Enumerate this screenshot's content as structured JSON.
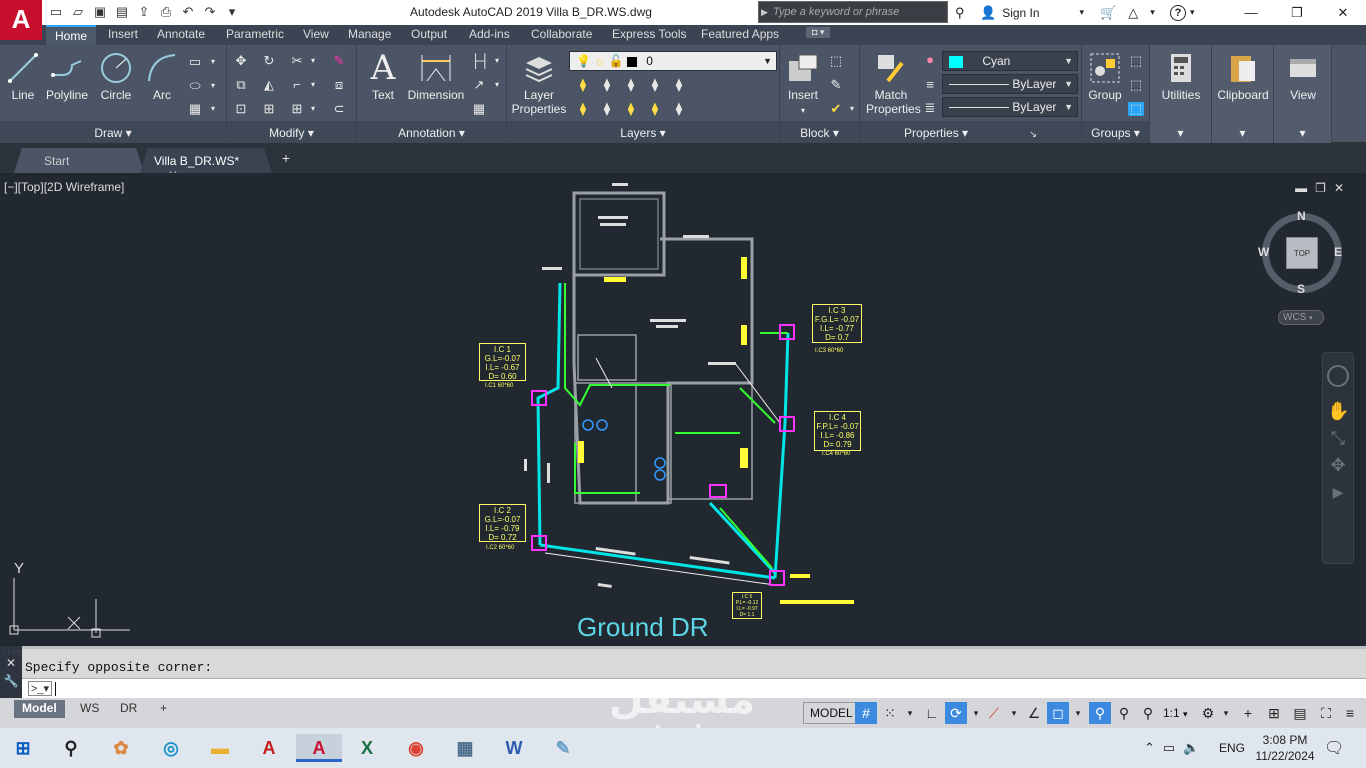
{
  "titlebar": {
    "app_button": "A",
    "window_title": "Autodesk AutoCAD 2019     Villa B_DR.WS.dwg",
    "search_placeholder": "Type a keyword or phrase",
    "sign_in": "Sign In",
    "help": "?"
  },
  "ribbon_tabs": [
    "Home",
    "Insert",
    "Annotate",
    "Parametric",
    "View",
    "Manage",
    "Output",
    "Add-ins",
    "Collaborate",
    "Express Tools",
    "Featured Apps"
  ],
  "panels": {
    "draw": {
      "title": "Draw",
      "line": "Line",
      "polyline": "Polyline",
      "circle": "Circle",
      "arc": "Arc"
    },
    "modify": {
      "title": "Modify"
    },
    "annotation": {
      "title": "Annotation",
      "text": "Text",
      "dimension": "Dimension"
    },
    "layers": {
      "title": "Layers",
      "layer_properties_1": "Layer",
      "layer_properties_2": "Properties",
      "current_layer": "0"
    },
    "block": {
      "title": "Block",
      "insert": "Insert"
    },
    "properties": {
      "title": "Properties",
      "match_1": "Match",
      "match_2": "Properties",
      "color": "Cyan",
      "linetype": "ByLayer",
      "lineweight": "ByLayer"
    },
    "groups": {
      "title": "Groups",
      "group": "Group"
    },
    "utilities": {
      "label": "Utilities"
    },
    "clipboard": {
      "label": "Clipboard"
    },
    "view": {
      "label": "View"
    }
  },
  "file_tabs": [
    {
      "label": "Start"
    },
    {
      "label": "Villa B_DR.WS*"
    }
  ],
  "viewport": {
    "label": "[−][Top][2D Wireframe]",
    "drawing_title": "Ground DR",
    "viewcube": {
      "top": "TOP",
      "n": "N",
      "s": "S",
      "e": "E",
      "w": "W",
      "wcs": "WCS"
    },
    "ucs": {
      "x": "X",
      "y": "Y"
    },
    "inspection_chambers": [
      {
        "id": "I.C 1",
        "lines": [
          "I.C 1",
          "G.L=-0.07",
          "I.L= -0.67",
          "D= 0.60"
        ],
        "size": "I.C1 60*60"
      },
      {
        "id": "I.C 2",
        "lines": [
          "I.C 2",
          "G.L=-0.07",
          "I.L= -0.79",
          "D= 0.72"
        ],
        "size": "I.C2 60*60"
      },
      {
        "id": "I.C 3",
        "lines": [
          "I.C 3",
          "F.G.L= -0.07",
          "I.L= -0.77",
          "D= 0.7"
        ],
        "size": "I.C3 60*60"
      },
      {
        "id": "I.C 4",
        "lines": [
          "I.C 4",
          "F.P.L= -0.07",
          "I.L= -0.86",
          "D= 0.79"
        ],
        "size": "I.C4 60*60"
      },
      {
        "id": "I.C 5",
        "lines": [
          "I.C 5",
          "P.L= -0.12",
          "I.L= -0.97",
          "D= 1.1"
        ],
        "size": ""
      }
    ]
  },
  "command": {
    "history": "Specify opposite corner:",
    "prompt": ""
  },
  "layout_tabs": [
    "Model",
    "WS",
    "DR"
  ],
  "status": {
    "model": "MODEL",
    "scale": "1:1"
  },
  "taskbar": {
    "language": "ENG",
    "time": "3:08 PM",
    "date": "11/22/2024"
  },
  "watermark": {
    "arabic": "مستقل",
    "latin": "mostaql.com"
  },
  "colors": {
    "accent": "#2aa4f4",
    "autocad_red": "#c8102e",
    "layer_cyan": "#00ffff",
    "chamber": "#ffff66"
  }
}
